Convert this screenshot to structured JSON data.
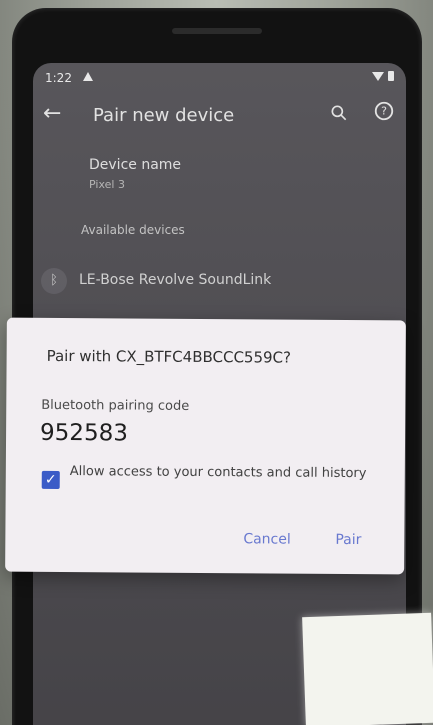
{
  "status_bar": {
    "time": "1:22"
  },
  "app_bar": {
    "title": "Pair new device",
    "back_icon": "arrow-left-icon",
    "search_icon": "search-icon",
    "help_icon": "help-icon"
  },
  "settings": {
    "device_name_title": "Device name",
    "device_name_value": "Pixel 3",
    "available_devices": "Available devices",
    "devices": [
      {
        "name": "LE-Bose Revolve SoundLink",
        "icon": "bluetooth-icon"
      }
    ]
  },
  "dialog": {
    "title": "Pair with CX_BTFC4BBCCC559C?",
    "code_label": "Bluetooth pairing code",
    "code_value": "952583",
    "checkbox_label": "Allow access to your contacts and call history",
    "checkbox_checked": true,
    "cancel_label": "Cancel",
    "pair_label": "Pair"
  },
  "colors": {
    "accent": "#6878cf",
    "checkbox": "#3b5bc7",
    "dialog_bg": "#f2eef2",
    "screen_bg": "#4f4d52"
  }
}
